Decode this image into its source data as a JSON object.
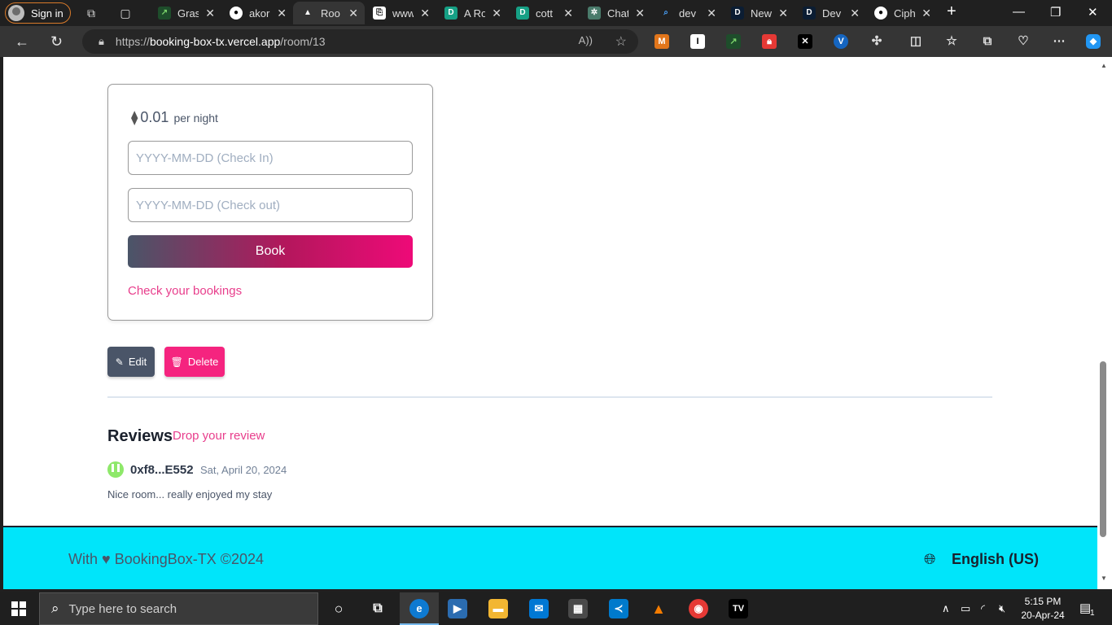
{
  "browser": {
    "sign_in_label": "Sign in",
    "tabs": [
      {
        "title": "Gras",
        "fav_bg": "#1e4d2b",
        "icon": "graph-icon"
      },
      {
        "title": "akor",
        "fav_bg": "#202020",
        "icon": "github-icon"
      },
      {
        "title": "Roo",
        "fav_bg": "#353535",
        "icon": "vercel-icon"
      },
      {
        "title": "www",
        "fav_bg": "#202020",
        "icon": "document-icon"
      },
      {
        "title": "A Ro",
        "fav_bg": "#16a085",
        "icon": "d-icon"
      },
      {
        "title": "cott",
        "fav_bg": "#16a085",
        "icon": "d-icon"
      },
      {
        "title": "Chat",
        "fav_bg": "#4a7b6b",
        "icon": "chatgpt-icon"
      },
      {
        "title": "dev",
        "fav_bg": "#202020",
        "icon": "search-icon"
      },
      {
        "title": "New",
        "fav_bg": "#0b1d33",
        "icon": "d-icon"
      },
      {
        "title": "Dev",
        "fav_bg": "#0b1d33",
        "icon": "d-icon"
      },
      {
        "title": "Ciph",
        "fav_bg": "#202020",
        "icon": "github-icon"
      }
    ],
    "url_prefix": "https://",
    "url_host": "booking-box-tx.vercel.app",
    "url_path": "/room/13"
  },
  "room": {
    "price": "0.01",
    "price_unit": "per night",
    "checkin_placeholder": "YYYY-MM-DD (Check In)",
    "checkout_placeholder": "YYYY-MM-DD (Check out)",
    "book_label": "Book",
    "check_bookings_label": "Check your bookings"
  },
  "actions": {
    "edit_label": "Edit",
    "delete_label": "Delete"
  },
  "reviews": {
    "heading": "Reviews",
    "drop_label": "Drop your review",
    "items": [
      {
        "user": "0xf8...E552",
        "date": "Sat, April 20, 2024",
        "text": "Nice room... really enjoyed my stay"
      }
    ]
  },
  "footer": {
    "text": "With ♥ BookingBox-TX ©2024",
    "language": "English (US)"
  },
  "taskbar": {
    "search_placeholder": "Type here to search",
    "time": "5:15 PM",
    "date": "20-Apr-24",
    "notifications": "1"
  },
  "colors": {
    "accent_pink": "#e83e8c",
    "delete_pink": "#f5247f",
    "footer_cyan": "#00e5fa",
    "slate": "#4a5568"
  }
}
